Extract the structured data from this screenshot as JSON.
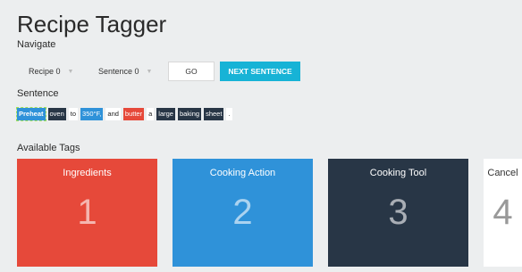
{
  "app": {
    "title": "Recipe Tagger"
  },
  "navigate": {
    "label": "Navigate",
    "recipe_select": "Recipe 0",
    "sentence_select": "Sentence 0",
    "go_label": "GO",
    "next_label": "NEXT SENTENCE"
  },
  "sentence": {
    "label": "Sentence",
    "tokens": [
      {
        "text": "Preheat",
        "tag": "selected"
      },
      {
        "text": "oven",
        "tag": "dark"
      },
      {
        "text": "to",
        "tag": "plain"
      },
      {
        "text": "350°F,",
        "tag": "blue"
      },
      {
        "text": "and",
        "tag": "plain"
      },
      {
        "text": "butter",
        "tag": "red"
      },
      {
        "text": "a",
        "tag": "plain"
      },
      {
        "text": "large",
        "tag": "dark"
      },
      {
        "text": "baking",
        "tag": "dark"
      },
      {
        "text": "sheet",
        "tag": "dark"
      },
      {
        "text": ".",
        "tag": "plain"
      }
    ]
  },
  "tags": {
    "label": "Available Tags",
    "items": [
      {
        "title": "Ingredients",
        "key": "1",
        "color": "#e6493a"
      },
      {
        "title": "Cooking Action",
        "key": "2",
        "color": "#2f92d9"
      },
      {
        "title": "Cooking Tool",
        "key": "3",
        "color": "#283646"
      },
      {
        "title": "Cancel",
        "key": "4",
        "color": "#ffffff"
      }
    ]
  }
}
